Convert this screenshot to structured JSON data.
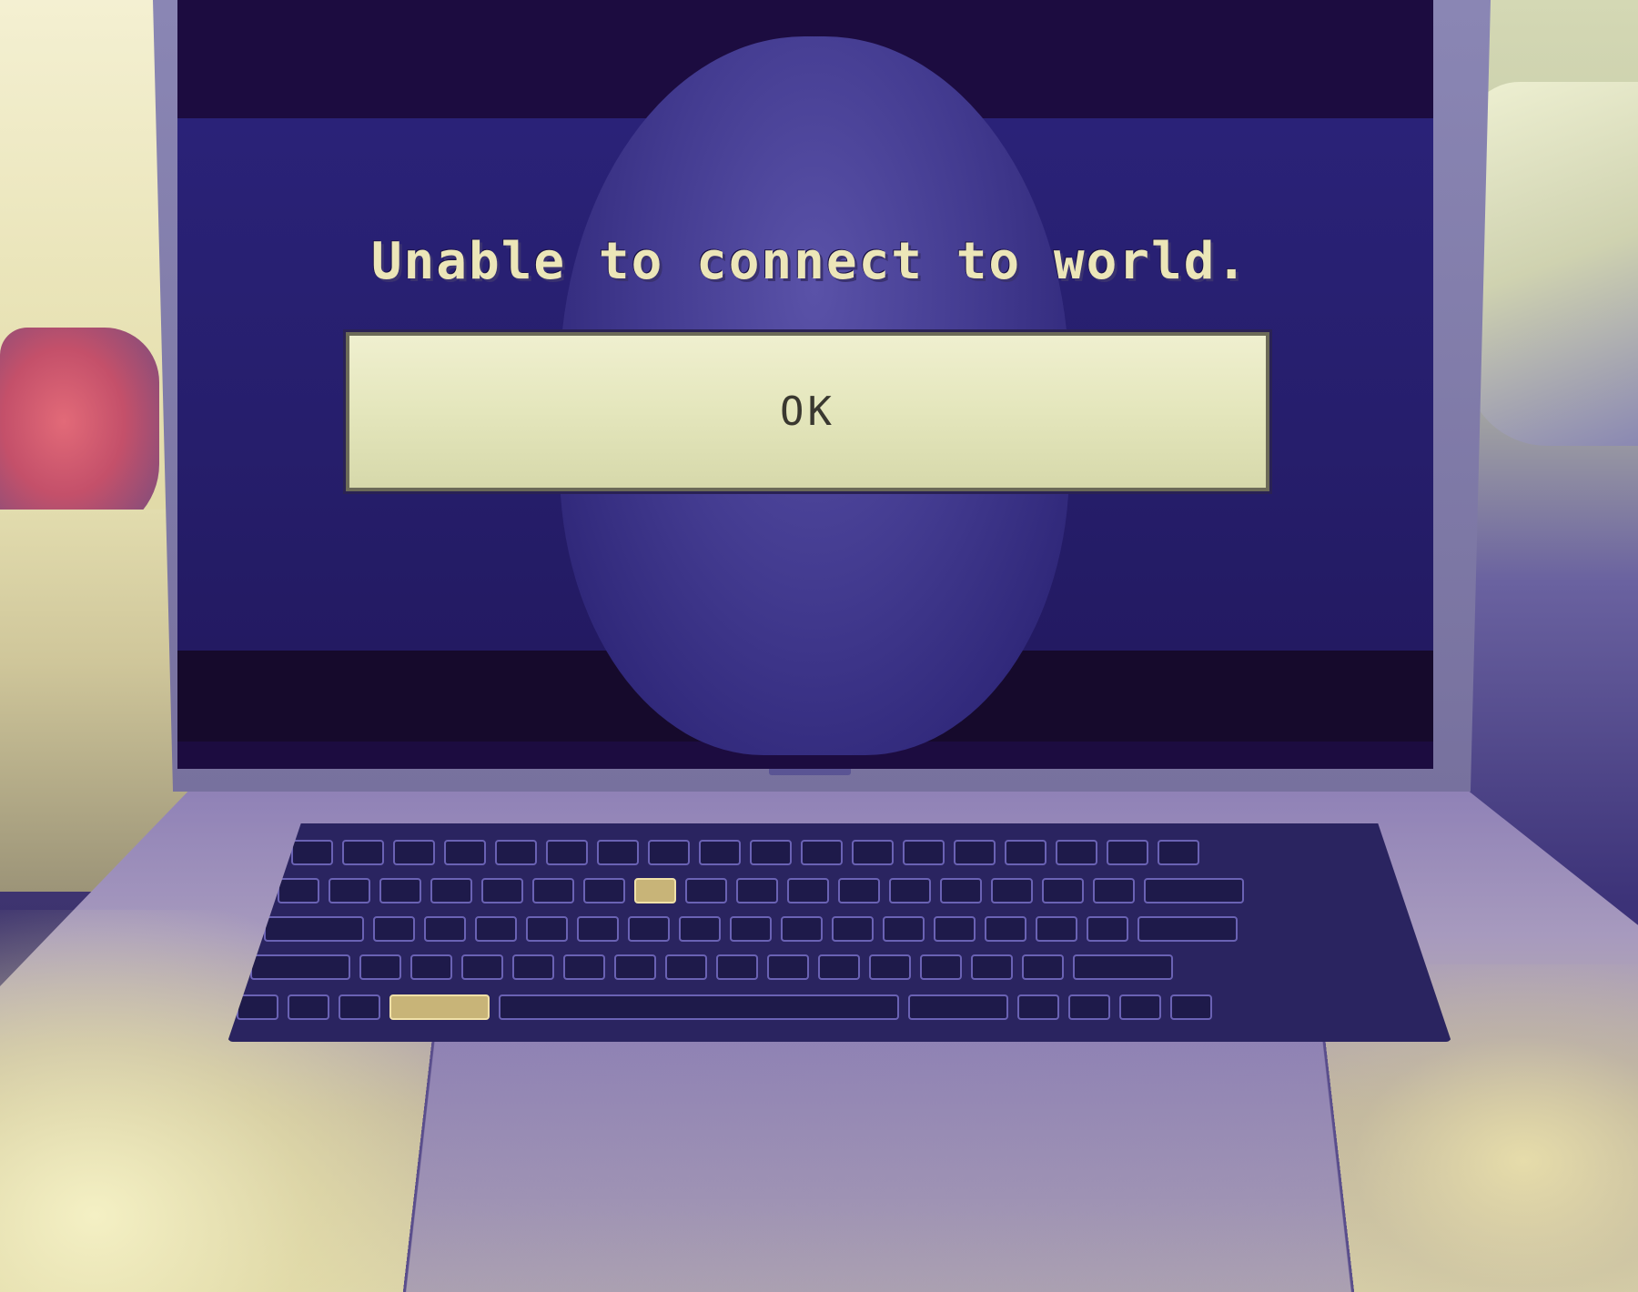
{
  "dialog": {
    "message": "Unable to connect to world.",
    "ok_label": "OK"
  },
  "colors": {
    "screen_background": "#261e6c",
    "message_text": "#ece6b8",
    "button_face": "#e4e6bc",
    "button_text": "#3a3830"
  }
}
